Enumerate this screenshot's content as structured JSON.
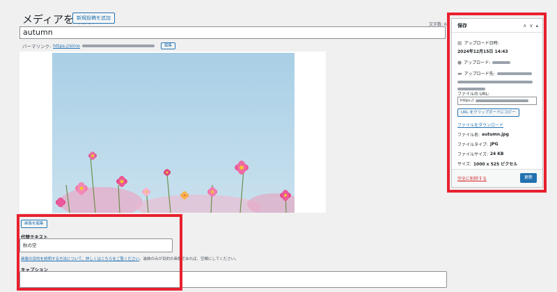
{
  "header": {
    "title": "メディアを編集",
    "add_new_label": "新規投稿を追加",
    "char_count": "文字数: 6"
  },
  "title_field": {
    "value": "autumn"
  },
  "permalink": {
    "label": "パーマリンク:",
    "url_visible": "https://simo",
    "edit_label": "編集"
  },
  "image_editor": {
    "edit_image_label": "画像を編集",
    "alt_label": "代替テキスト",
    "alt_value": "秋の空",
    "alt_help_link": "画像の目的を説明する方法について、詳しくはこちらをご覧ください",
    "alt_help_rest": "。装飾のみが目的の画像であれば、空欄にしてください。",
    "caption_label": "キャプション",
    "caption_value": ""
  },
  "save_box": {
    "title": "保存",
    "uploaded_on_label": "アップロード日時:",
    "uploaded_on_value": "2024年12月15日 14:43",
    "uploaded_by_label": "アップロード:",
    "uploaded_to_label": "アップロード先:",
    "file_url_label": "ファイルの URL:",
    "file_url_value": "https://",
    "copy_url_label": "URL をクリップボードにコピー",
    "download_label": "ファイルをダウンロード",
    "file_name_label": "ファイル名:",
    "file_name_value": "autumn.jpg",
    "file_type_label": "ファイルタイプ:",
    "file_type_value": "JPG",
    "file_size_label": "ファイルサイズ:",
    "file_size_value": "24 KB",
    "dimensions_label": "サイズ:",
    "dimensions_value": "1000 x 525 ピクセル",
    "delete_label": "完全に削除する",
    "update_label": "更新"
  },
  "colors": {
    "highlight": "#e8202e",
    "link": "#2271b1",
    "delete": "#d63638"
  }
}
